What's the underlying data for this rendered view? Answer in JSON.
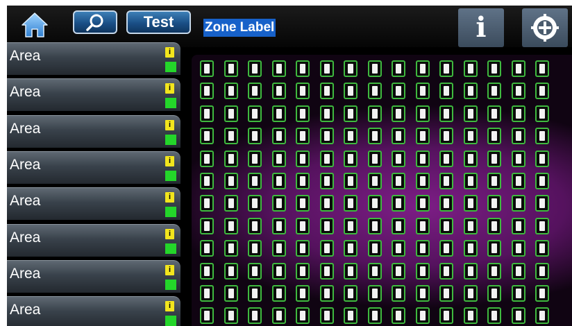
{
  "toolbar": {
    "test_label": "Test",
    "zone_label": "Zone Label",
    "info_glyph": "i",
    "icons": {
      "home": "home-icon",
      "search": "magnifier-icon",
      "info": "info-icon",
      "settings": "crosshair-settings-icon"
    }
  },
  "sidebar": {
    "areas": [
      {
        "label": "Area",
        "badge": "i"
      },
      {
        "label": "Area",
        "badge": "i"
      },
      {
        "label": "Area",
        "badge": "i"
      },
      {
        "label": "Area",
        "badge": "i"
      },
      {
        "label": "Area",
        "badge": "i"
      },
      {
        "label": "Area",
        "badge": "i"
      },
      {
        "label": "Area",
        "badge": "i"
      },
      {
        "label": "Area",
        "badge": "i"
      }
    ]
  },
  "zone_grid": {
    "rows": 12,
    "columns": 15,
    "cell_status": "ok"
  },
  "colors": {
    "accent": "#1761c9",
    "status_ok": "#24d62a",
    "status_info": "#f2e51d",
    "zone_border": "#3fb93f",
    "grid_glow": "#7d1e86"
  }
}
